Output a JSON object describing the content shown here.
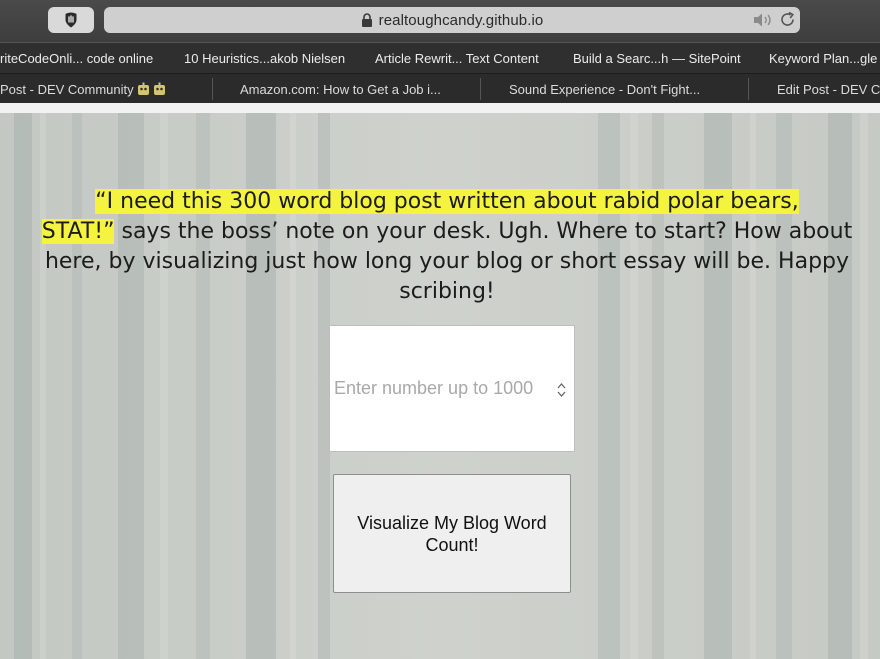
{
  "browser": {
    "url_domain": "realtoughcandy.github.io",
    "icons": [
      "privacy-shield-icon",
      "lock-icon",
      "speaker-icon",
      "reload-icon"
    ]
  },
  "bookmarks": [
    "riteCodeOnli... code online",
    "10 Heuristics...akob Nielsen",
    "Article Rewrit... Text Content",
    "Build a Searc...h — SitePoint",
    "Keyword Plan...gle"
  ],
  "tabs": [
    "Post - DEV Community",
    "Amazon.com: How to Get a Job i...",
    "Sound Experience - Don't Fight...",
    "Edit Post - DEV C"
  ],
  "main": {
    "intro_highlight_1": "“I need this 300 word blog post written about rabid polar bears,",
    "intro_highlight_2": "STAT!”",
    "intro_rest": " says the boss’ note on your desk. Ugh. Where to start? How about here, by visualizing just how long your blog or short essay will be. Happy scribing!",
    "number_input": {
      "value": "",
      "placeholder": "Enter number up to 1000"
    },
    "visualize_button_label": "Visualize My Blog Word Count!"
  },
  "colors": {
    "highlight": "#f4f440",
    "page_background": "#c9cdc7"
  }
}
